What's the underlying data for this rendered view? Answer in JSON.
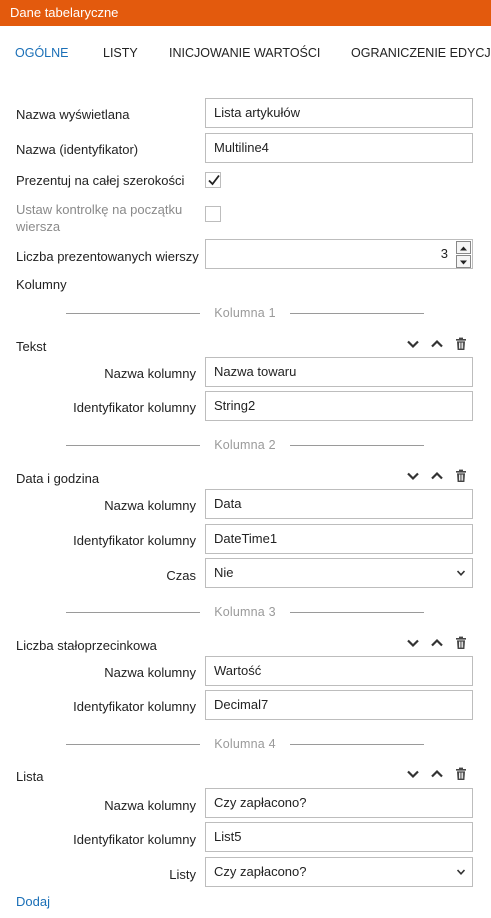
{
  "header": {
    "title": "Dane tabelaryczne",
    "bg_color": "#e35a0d"
  },
  "tabs": [
    {
      "label": "OGÓLNE",
      "active": true
    },
    {
      "label": "LISTY",
      "active": false
    },
    {
      "label": "INICJOWANIE WARTOŚCI",
      "active": false
    },
    {
      "label": "OGRANICZENIE EDYCJI",
      "active": false
    }
  ],
  "general": {
    "display_name_label": "Nazwa wyświetlana",
    "display_name_value": "Lista artykułów",
    "identifier_label": "Nazwa (identyfikator)",
    "identifier_value": "Multiline4",
    "full_width_label": "Prezentuj na całej szerokości",
    "full_width_checked": true,
    "row_start_label_line1": "Ustaw kontrolkę na początku",
    "row_start_label_line2": "wiersza",
    "row_start_checked": false,
    "rows_label": "Liczba prezentowanych wierszy",
    "rows_value": "3",
    "columns_label": "Kolumny"
  },
  "columns": [
    {
      "divider": "Kolumna 1",
      "type": "Tekst",
      "name_label": "Nazwa kolumny",
      "name_value": "Nazwa towaru",
      "id_label": "Identyfikator kolumny",
      "id_value": "String2"
    },
    {
      "divider": "Kolumna 2",
      "type": "Data i godzina",
      "name_label": "Nazwa kolumny",
      "name_value": "Data",
      "id_label": "Identyfikator kolumny",
      "id_value": "DateTime1",
      "extra_label": "Czas",
      "extra_value": "Nie"
    },
    {
      "divider": "Kolumna 3",
      "type": "Liczba stałoprzecinkowa",
      "name_label": "Nazwa kolumny",
      "name_value": "Wartość",
      "id_label": "Identyfikator kolumny",
      "id_value": "Decimal7"
    },
    {
      "divider": "Kolumna 4",
      "type": "Lista",
      "name_label": "Nazwa kolumny",
      "name_value": "Czy zapłacono?",
      "id_label": "Identyfikator kolumny",
      "id_value": "List5",
      "extra_label": "Listy",
      "extra_value": "Czy zapłacono?"
    }
  ],
  "add_link": "Dodaj",
  "icons": {
    "move_down": "chevron-down-icon",
    "move_up": "chevron-up-icon",
    "delete": "trash-icon",
    "checkmark": "checkmark-icon",
    "select_arrow": "chevron-down-icon"
  },
  "colors": {
    "accent": "#1a6fb7",
    "border": "#bdbdbd",
    "muted": "#8a8a8a"
  }
}
